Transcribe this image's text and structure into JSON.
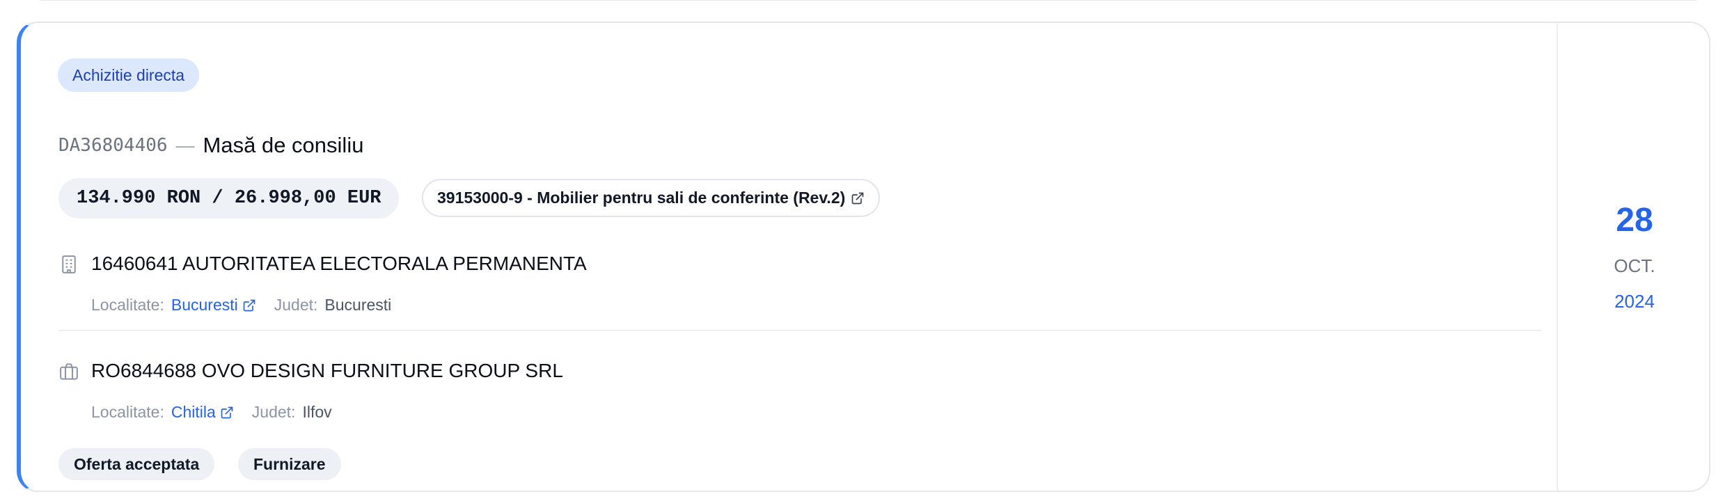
{
  "procedure": {
    "type_label": "Achizitie directa",
    "reference": "DA36804406",
    "separator": "—",
    "title": "Masă de consiliu",
    "price": "134.990 RON / 26.998,00 EUR",
    "cpv": "39153000-9 - Mobilier pentru sali de conferinte (Rev.2)"
  },
  "authority": {
    "icon": "building-icon",
    "name": "16460641 AUTORITATEA ELECTORALA PERMANENTA",
    "locality_label": "Localitate:",
    "locality": "Bucuresti",
    "county_label": "Judet:",
    "county": "Bucuresti"
  },
  "supplier": {
    "icon": "briefcase-icon",
    "name": "RO6844688 OVO DESIGN FURNITURE GROUP SRL",
    "locality_label": "Localitate:",
    "locality": "Chitila",
    "county_label": "Judet:",
    "county": "Ilfov"
  },
  "tags": [
    "Oferta acceptata",
    "Furnizare"
  ],
  "date": {
    "day": "28",
    "month": "OCT.",
    "year": "2024"
  },
  "colors": {
    "accent": "#3b82f6",
    "link": "#2563eb",
    "type_pill_bg": "#dbe8fd",
    "type_pill_text": "#1e40af"
  }
}
